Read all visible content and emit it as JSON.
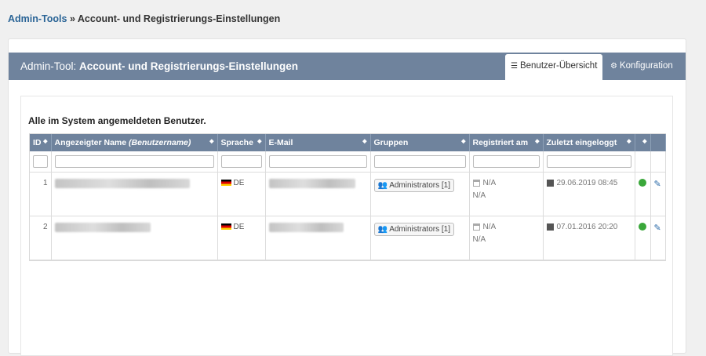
{
  "breadcrumb": {
    "link": "Admin-Tools",
    "separator": "»",
    "current": "Account- und Registrierungs-Einstellungen"
  },
  "panel": {
    "title_prefix": "Admin-Tool:",
    "title_main": "Account- und Registrierungs-Einstellungen",
    "tabs": [
      {
        "label": "Benutzer-Übersicht",
        "icon": "list-icon",
        "active": true
      },
      {
        "label": "Konfiguration",
        "icon": "gear-icon",
        "active": false
      }
    ]
  },
  "table": {
    "title": "Alle im System angemeldeten Benutzer.",
    "columns": {
      "id": "ID",
      "name": "Angezeigter Name",
      "name_suffix": "(Benutzername)",
      "language": "Sprache",
      "email": "E-Mail",
      "groups": "Gruppen",
      "registered": "Registriert am",
      "last_login": "Zuletzt eingeloggt"
    },
    "rows": [
      {
        "id": "1",
        "language": "DE",
        "group": "Administrators [1]",
        "registered": "N/A",
        "registered_sub": "N/A",
        "last_login": "29.06.2019 08:45"
      },
      {
        "id": "2",
        "language": "DE",
        "group": "Administrators [1]",
        "registered": "N/A",
        "registered_sub": "N/A",
        "last_login": "07.01.2016 20:20"
      }
    ]
  },
  "colors": {
    "header": "#6f839d",
    "link": "#2a6496",
    "status_green": "#3aa73a",
    "edit_blue": "#2a6aa8"
  }
}
